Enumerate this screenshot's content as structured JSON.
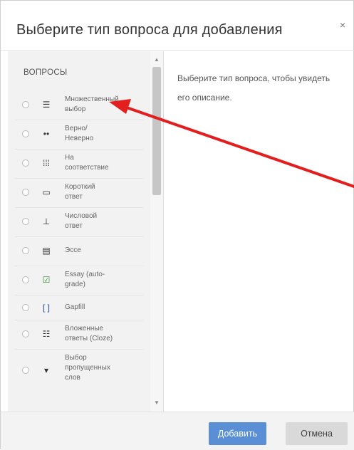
{
  "dialog": {
    "title": "Выберите тип вопроса для добавления",
    "close_symbol": "×"
  },
  "left_panel": {
    "section_title": "ВОПРОСЫ",
    "items": [
      {
        "label_lines": [
          "Множественный",
          "выбор"
        ],
        "icon": "list-icon"
      },
      {
        "label_lines": [
          "Верно/",
          "Неверно"
        ],
        "icon": "dots-icon"
      },
      {
        "label_lines": [
          "На",
          "соответствие"
        ],
        "icon": "match-icon"
      },
      {
        "label_lines": [
          "Короткий",
          "ответ"
        ],
        "icon": "short-answer-icon"
      },
      {
        "label_lines": [
          "Числовой",
          "ответ"
        ],
        "icon": "numeric-icon"
      },
      {
        "label_lines": [
          "Эссе"
        ],
        "icon": "essay-icon"
      },
      {
        "label_lines": [
          "Essay (auto-",
          "grade)"
        ],
        "icon": "essay-autograde-icon"
      },
      {
        "label_lines": [
          "Gapfill"
        ],
        "icon": "gapfill-icon"
      },
      {
        "label_lines": [
          "Вложенные",
          "ответы (Cloze)"
        ],
        "icon": "cloze-icon"
      },
      {
        "label_lines": [
          "Выбор",
          "пропущенных",
          "слов"
        ],
        "icon": "dropdown-icon"
      }
    ]
  },
  "description": {
    "text": "Выберите тип вопроса, чтобы увидеть его описание."
  },
  "footer": {
    "add_label": "Добавить",
    "cancel_label": "Отмена"
  },
  "colors": {
    "accent": "#5a8fd6",
    "arrow": "#e21e1e"
  }
}
